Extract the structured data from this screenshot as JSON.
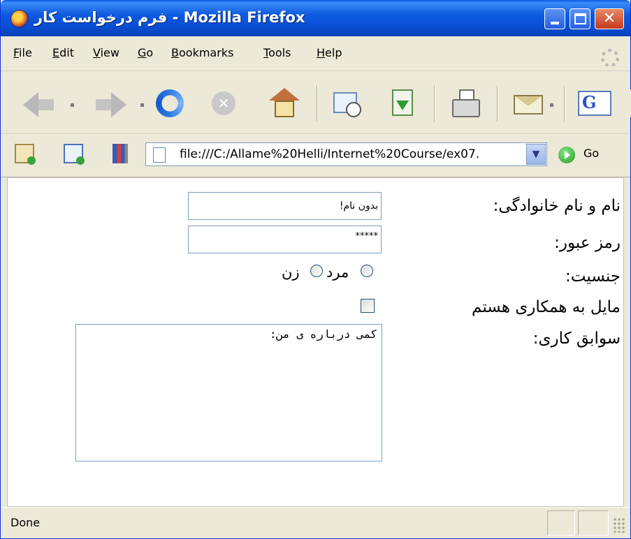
{
  "window": {
    "title": "فرم درخواست کار - Mozilla Firefox"
  },
  "menu": {
    "file": {
      "accel": "F",
      "rest": "ile"
    },
    "edit": {
      "accel": "E",
      "rest": "dit"
    },
    "view": {
      "accel": "V",
      "rest": "iew"
    },
    "go": {
      "accel": "G",
      "rest": "o"
    },
    "bookmarks": {
      "accel": "B",
      "rest": "ookmarks"
    },
    "tools": {
      "accel": "T",
      "rest": "ools"
    },
    "help": {
      "accel": "H",
      "rest": "elp"
    }
  },
  "toolbar": {
    "icons": [
      "back-icon",
      "forward-icon",
      "reload-icon",
      "stop-icon",
      "home-icon",
      "history-icon",
      "download-icon",
      "print-icon",
      "mail-icon",
      "google-icon"
    ],
    "google_letter": "G"
  },
  "addressbar": {
    "url": "file:///C:/Allame%20Helli/Internet%20Course/ex07.",
    "go_label": "Go",
    "dropdown_glyph": "▼"
  },
  "form": {
    "name_label": "نام و نام خانوادگی:",
    "name_value": "بدون نام!",
    "password_label": "رمز عبور:",
    "password_value": "*****",
    "gender_label": "جنسیت:",
    "gender_male": "مرد",
    "gender_female": "زن",
    "cooperate_label": "مایل به همکاری هستم",
    "experience_label": "سوابق کاری:",
    "experience_value": "کمی درباره ی من:"
  },
  "status": {
    "text": "Done"
  },
  "colors": {
    "titlebar": "#0a4fd6",
    "chrome": "#ece9d8",
    "input_border": "#7f9db9",
    "close_button": "#c5391a"
  }
}
